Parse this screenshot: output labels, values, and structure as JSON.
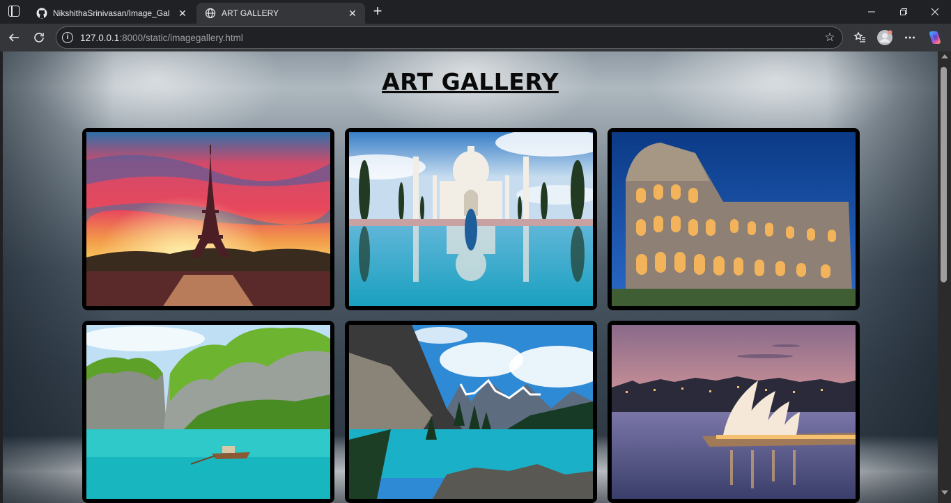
{
  "browser": {
    "tabs": [
      {
        "title": "NikshithaSrinivasan/Image_Galler",
        "icon": "github-icon",
        "active": false
      },
      {
        "title": "ART GALLERY",
        "icon": "globe-icon",
        "active": true
      }
    ],
    "address": {
      "host": "127.0.0.1",
      "rest": ":8000/static/imagegallery.html"
    }
  },
  "page": {
    "title": "ART GALLERY",
    "images": [
      {
        "subject": "eiffel-tower-sunset"
      },
      {
        "subject": "taj-mahal-reflection"
      },
      {
        "subject": "colosseum-night"
      },
      {
        "subject": "tropical-cliffs-boat"
      },
      {
        "subject": "mountain-lake"
      },
      {
        "subject": "sydney-opera-house-dusk"
      }
    ]
  },
  "colors": {
    "accent": "#8ab4f8",
    "card_border": "#000000"
  }
}
